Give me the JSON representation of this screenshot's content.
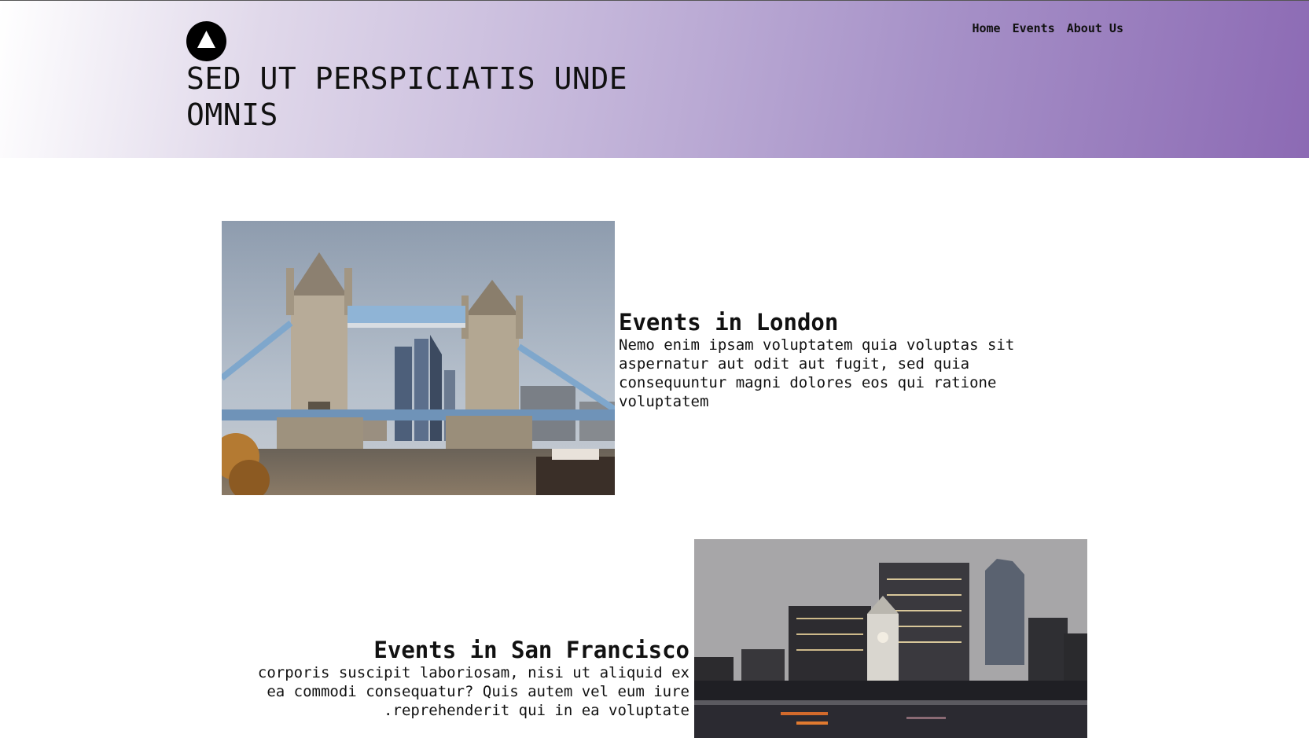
{
  "header": {
    "logo_icon": "triangle-icon",
    "title": "SED UT PERSPICIATIS UNDE OMNIS",
    "nav": [
      {
        "label": "Home"
      },
      {
        "label": "Events"
      },
      {
        "label": "About Us"
      }
    ],
    "gradient_colors": [
      "#ffffff",
      "#c4b6da",
      "#8c6ab4"
    ]
  },
  "events": [
    {
      "title": "Events in London",
      "description": "Nemo enim ipsam voluptatem quia voluptas sit aspernatur aut odit aut fugit, sed quia consequuntur magni dolores eos qui ratione voluptatem",
      "image": "tower-bridge-photo"
    },
    {
      "title": "Events in San Francisco",
      "description": "corporis suscipit laboriosam, nisi ut aliquid ex ea commodi consequatur? Quis autem vel eum iure reprehenderit qui in ea voluptate.",
      "image": "san-francisco-skyline-photo"
    }
  ]
}
